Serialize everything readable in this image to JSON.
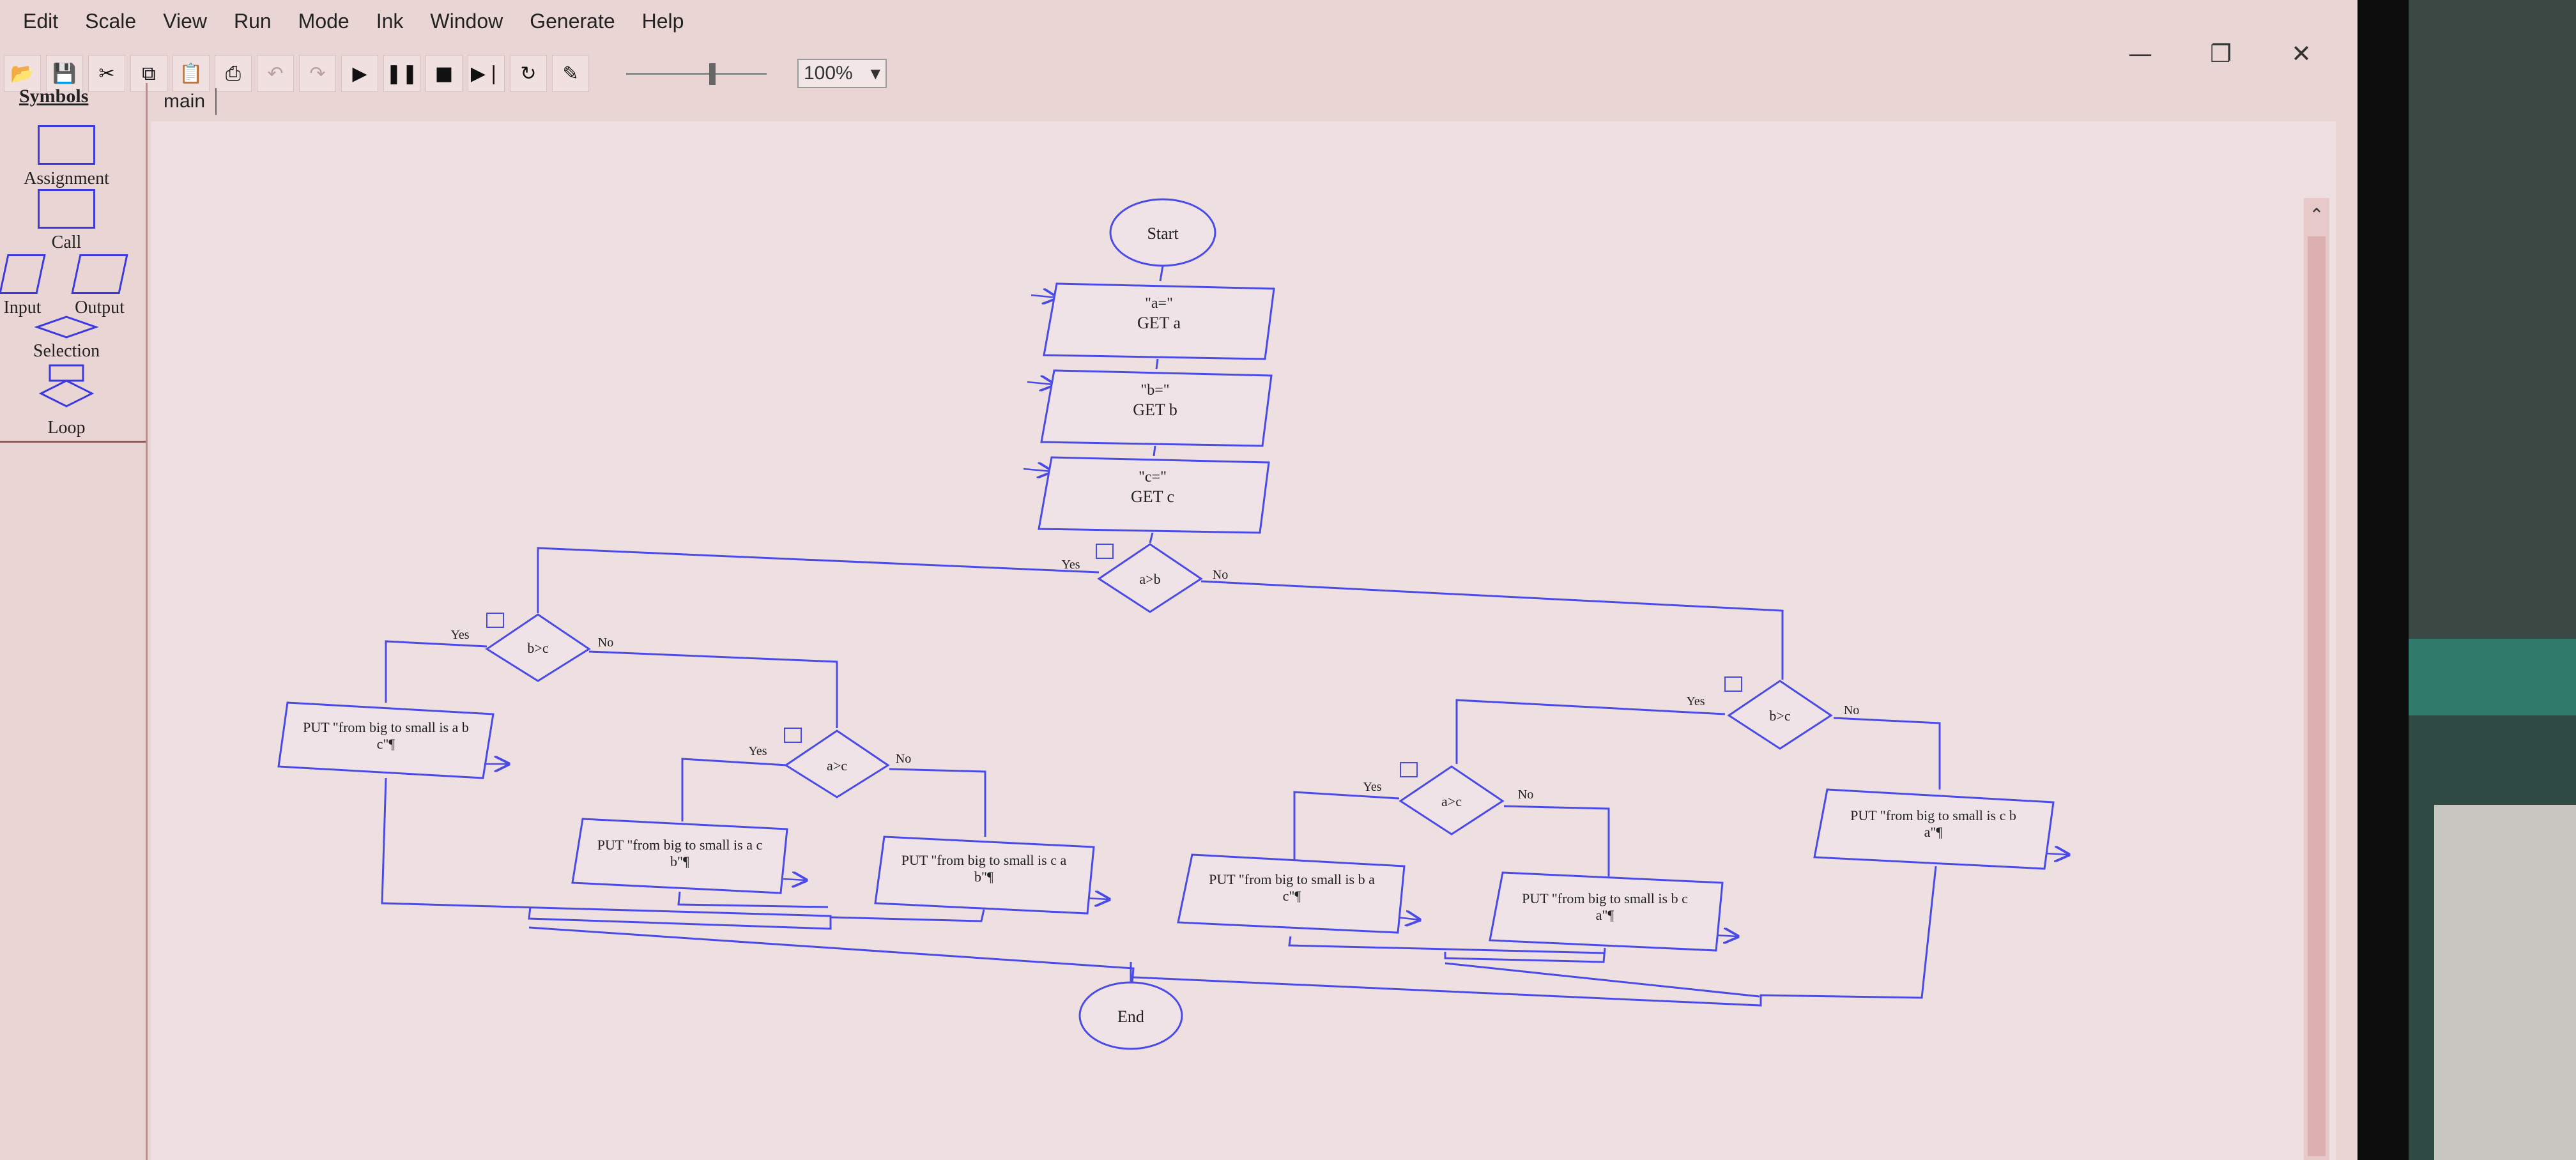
{
  "menubar": {
    "items": [
      "Edit",
      "Scale",
      "View",
      "Run",
      "Mode",
      "Ink",
      "Window",
      "Generate",
      "Help"
    ]
  },
  "window_controls": {
    "minimize_icon": "minimize-icon",
    "restore_icon": "restore-icon",
    "close_icon": "close-icon"
  },
  "toolbar": {
    "buttons": [
      "open-icon",
      "save-icon",
      "cut-icon",
      "copy-icon",
      "paste-icon",
      "print-icon",
      "undo-icon",
      "redo-icon",
      "run-icon",
      "pause-icon",
      "stop-icon",
      "step-icon",
      "reset-icon",
      "pen-icon"
    ],
    "zoom_value": "100%",
    "zoom_slider_level_percent": 60
  },
  "symbols_panel": {
    "title": "Symbols",
    "items": {
      "assignment": "Assignment",
      "call": "Call",
      "input": "Input",
      "output": "Output",
      "selection": "Selection",
      "loop": "Loop"
    }
  },
  "tabs": [
    {
      "label": "main",
      "active": true
    }
  ],
  "flowchart": {
    "start": "Start",
    "end": "End",
    "inputs": [
      {
        "prompt": "\"a=\"",
        "get": "GET a"
      },
      {
        "prompt": "\"b=\"",
        "get": "GET b"
      },
      {
        "prompt": "\"c=\"",
        "get": "GET c"
      }
    ],
    "decisions": {
      "d_main": "a>b",
      "d_left": "b>c",
      "d_left_inner": "a>c",
      "d_right": "b>c",
      "d_right_inner": "a>c"
    },
    "branch_labels": {
      "yes": "Yes",
      "no": "No"
    },
    "outputs": {
      "o_abc_1": "PUT \"from big to small is a b",
      "o_abc_2": "c\"¶",
      "o_acb_1": "PUT \"from big to small is a c",
      "o_acb_2": "b\"¶",
      "o_cab_1": "PUT \"from big to small is c a",
      "o_cab_2": "b\"¶",
      "o_bac_1": "PUT \"from big to small is b a",
      "o_bac_2": "c\"¶",
      "o_bca_1": "PUT \"from big to small is b c",
      "o_bca_2": "a\"¶",
      "o_cba_1": "PUT \"from big to small is c b",
      "o_cba_2": "a\"¶"
    }
  },
  "colors": {
    "flow_line": "#4a4ae6",
    "window_bg": "#ead5d5",
    "canvas_bg": "#eee0e0"
  }
}
